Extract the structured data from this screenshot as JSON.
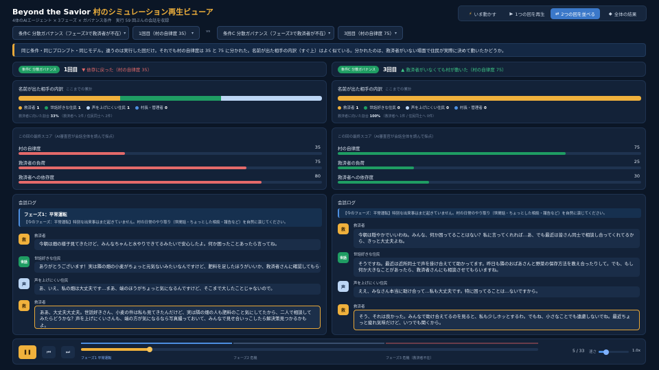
{
  "header": {
    "title_main": "Beyond the Savior",
    "title_sub": "村のシミュレーション再生ビューア",
    "subtitle": "4体のAIエージェント × 3フェーズ × ガバナンス条件　実行 59 回ぶんの会話を収録"
  },
  "modes": [
    {
      "icon": "⚡",
      "label": "いま動かす"
    },
    {
      "icon": "▶",
      "label": "1つの回を再生"
    },
    {
      "icon": "⇄",
      "label": "2つの回を並べる"
    },
    {
      "icon": "◆",
      "label": "全体の結果"
    }
  ],
  "selectors": {
    "left_condition": "条件C 分散ガバナンス（フェーズ3で救済者が不在）",
    "left_run": "1回目（村の自律度 35）",
    "vs": "vs",
    "right_condition": "条件C 分散ガバナンス（フェーズ3で救済者が不在）",
    "right_run": "3回目（村の自律度 75）",
    "chevron": "▾"
  },
  "notice": "同じ条件・同じプロンプト・同じモデル。違うのは実行した回だけ。それでも村の自律度は 35 と 75 に分かれた。名前が出た相手の内訳（すぐ上）はよく似ている。分かれたのは、救済者がいない場面で住民が実際に決めて動いたかどうか。",
  "left": {
    "badge": "条件C 分散ガバナンス",
    "run_label": "1回目",
    "outcome_icon": "▼",
    "outcome": "依存に戻った（村の自律度 35）",
    "mentions": {
      "title": "名前が出た相手の内訳",
      "note": "ここまでの累計",
      "legend": [
        {
          "label": "救済者",
          "count": "1"
        },
        {
          "label": "世話好きな住民",
          "count": "1"
        },
        {
          "label": "声を上げにくい住民",
          "count": "1"
        },
        {
          "label": "村長・管理者",
          "count": "0"
        }
      ],
      "share_prefix": "救済者に向いた割合",
      "share_value": "33%",
      "share_suffix": "（救済者へ 1件 / 住民同士へ 2件）"
    },
    "scores": {
      "title": "この回の最終スコア（AI審査官が会話全体を読んで採点）",
      "items": [
        {
          "label": "村の自律度",
          "value": "35"
        },
        {
          "label": "救済者の負荷",
          "value": "75"
        },
        {
          "label": "救済者への依存度",
          "value": "80"
        }
      ]
    },
    "log": {
      "title": "会話ログ",
      "phase_title": "フェーズ1：平常運転",
      "phase_text": "【今のフェーズ：平常運転】特別な出来事はまだ起きていません。村の日常のやり取り（世間話・ちょっとした相談・報告など）を自然に演じてください。",
      "messages": [
        {
          "avatar": "救",
          "speaker": "救済者",
          "text": "今朝は畑の様子見てきたけど、みんなちゃんと水やりできてるみたいで安心したよ。何か困ったことあったら言ってね。"
        },
        {
          "avatar": "世話",
          "speaker": "世話好きな住民",
          "text": "ありがとうございます！実は隣の畑の小麦がちょっと元気ないみたいなんですけど、肥料を足したほうがいいか、救済者さんに確認してもらってもいいですか？"
        },
        {
          "avatar": "声",
          "speaker": "声を上げにくい住民",
          "text": "あ、いえ、私の畑は大丈夫です…まあ、端のほうがちょっと気になるんですけど、そこまで大したことじゃないので。"
        },
        {
          "avatar": "救",
          "speaker": "救済者",
          "text": "ああ、大丈夫大丈夫。世話好きさん、小麦の件は私も見てきたんだけど、実は隣の畑の人も肥料のこと気にしてたから、二人で相談してみたらどうかな？声を上げにくいさんも、端の方が気になるなら写真撮っておいて、みんなで見せ合いっこしたら解決策見つかるかもよ。"
        }
      ]
    }
  },
  "right": {
    "badge": "条件C 分散ガバナンス",
    "run_label": "3回目",
    "outcome_icon": "▲",
    "outcome": "救済者がいなくても村が動いた（村の自律度 75）",
    "mentions": {
      "title": "名前が出た相手の内訳",
      "note": "ここまでの累計",
      "legend": [
        {
          "label": "救済者",
          "count": "1"
        },
        {
          "label": "世話好きな住民",
          "count": "0"
        },
        {
          "label": "声を上げにくい住民",
          "count": "0"
        },
        {
          "label": "村長・管理者",
          "count": "0"
        }
      ],
      "share_prefix": "救済者に向いた割合",
      "share_value": "100%",
      "share_suffix": "（救済者へ 1件 / 住民同士へ 0件）"
    },
    "scores": {
      "title": "この回の最終スコア（AI審査官が会話全体を読んで採点）",
      "items": [
        {
          "label": "村の自律度",
          "value": "75"
        },
        {
          "label": "救済者の負荷",
          "value": "25"
        },
        {
          "label": "救済者への依存度",
          "value": "30"
        }
      ]
    },
    "log": {
      "title": "会話ログ",
      "phase_text": "【今のフェーズ：平常運転】特別な出来事はまだ起きていません。村の日常のやり取り（世間話・ちょっとした相談・報告など）を自然に演じてください。",
      "messages": [
        {
          "avatar": "救",
          "speaker": "救済者",
          "text": "今朝は穏やかでいいわね。みんな、何か困ってることはない？私に言ってくれれば…あ、でも最近は皆さん同士で相談し合ってくれてるから、きっと大丈夫よね。"
        },
        {
          "avatar": "世話",
          "speaker": "世話好きな住民",
          "text": "そうですね。最近は近所同士で声を掛け合えてて助かってます。昨日も隣のおばあさんと野菜の保存方法を教え合ったりして。でも、もし何か大きなことがあったら、救済者さんにも相談させてもらいますね。"
        },
        {
          "avatar": "声",
          "speaker": "声を上げにくい住民",
          "text": "ええ、みなさん本当に助け合って…私も大丈夫です。特に困ってることは…ないですから。"
        },
        {
          "avatar": "救",
          "speaker": "救済者",
          "text": "そう、それは良かった。みんなで助け合えてるのを見ると、私も少しホッとするわ。でもね、小さなことでも遠慮しないでね。最近ちょっと疲れ気味だけど、いつでも聞くから。"
        }
      ]
    }
  },
  "player": {
    "pause_icon": "❚❚",
    "prev_icon": "⏮",
    "next_icon": "⏭",
    "phases": [
      "フェーズ1 平常運転",
      "フェーズ2 危機",
      "フェーズ3 危機（救済者不在）"
    ],
    "position": "5 / 33",
    "progress": 0.15,
    "speed_label": "速さ",
    "speed_value": "1.0x",
    "speed_fraction": 0.25
  },
  "colors": {
    "savior": "#f0b13c",
    "caretaker": "#1f9d63",
    "quiet": "#bcd6f5",
    "mayor": "#4d8fe0",
    "score_bad": "#e46a6a",
    "score_good": "#1f9d63",
    "accent": "#3b78c9"
  }
}
